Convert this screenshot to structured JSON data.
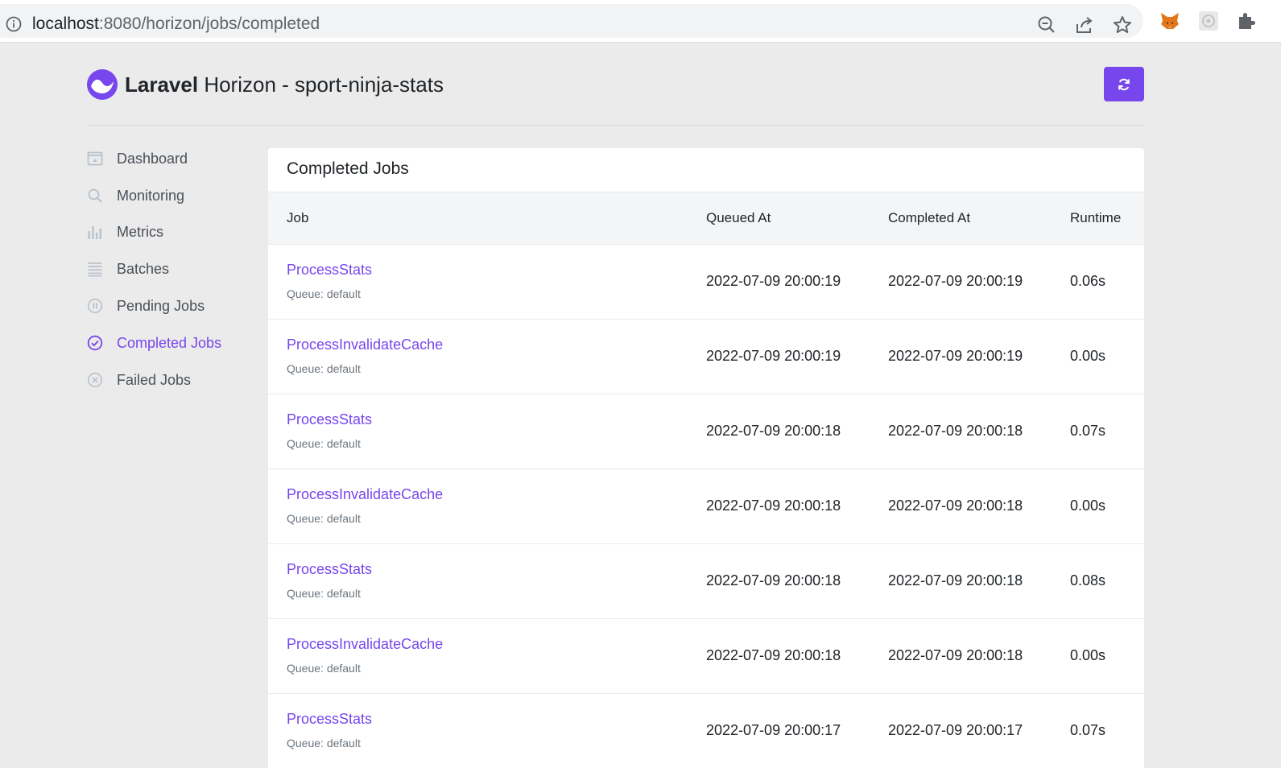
{
  "browser": {
    "url_host": "localhost",
    "url_rest": ":8080/horizon/jobs/completed"
  },
  "header": {
    "brand_bold": "Laravel",
    "brand_rest": "Horizon - sport-ninja-stats"
  },
  "sidebar": {
    "items": [
      {
        "label": "Dashboard",
        "icon": "dashboard-icon",
        "active": false
      },
      {
        "label": "Monitoring",
        "icon": "search-icon",
        "active": false
      },
      {
        "label": "Metrics",
        "icon": "bar-chart-icon",
        "active": false
      },
      {
        "label": "Batches",
        "icon": "list-icon",
        "active": false
      },
      {
        "label": "Pending Jobs",
        "icon": "pause-icon",
        "active": false
      },
      {
        "label": "Completed Jobs",
        "icon": "check-circle-icon",
        "active": true
      },
      {
        "label": "Failed Jobs",
        "icon": "x-circle-icon",
        "active": false
      }
    ]
  },
  "card": {
    "title": "Completed Jobs",
    "columns": {
      "job": "Job",
      "queued_at": "Queued At",
      "completed_at": "Completed At",
      "runtime": "Runtime"
    },
    "rows": [
      {
        "job": "ProcessStats",
        "queue": "Queue: default",
        "queued_at": "2022-07-09 20:00:19",
        "completed_at": "2022-07-09 20:00:19",
        "runtime": "0.06s"
      },
      {
        "job": "ProcessInvalidateCache",
        "queue": "Queue: default",
        "queued_at": "2022-07-09 20:00:19",
        "completed_at": "2022-07-09 20:00:19",
        "runtime": "0.00s"
      },
      {
        "job": "ProcessStats",
        "queue": "Queue: default",
        "queued_at": "2022-07-09 20:00:18",
        "completed_at": "2022-07-09 20:00:18",
        "runtime": "0.07s"
      },
      {
        "job": "ProcessInvalidateCache",
        "queue": "Queue: default",
        "queued_at": "2022-07-09 20:00:18",
        "completed_at": "2022-07-09 20:00:18",
        "runtime": "0.00s"
      },
      {
        "job": "ProcessStats",
        "queue": "Queue: default",
        "queued_at": "2022-07-09 20:00:18",
        "completed_at": "2022-07-09 20:00:18",
        "runtime": "0.08s"
      },
      {
        "job": "ProcessInvalidateCache",
        "queue": "Queue: default",
        "queued_at": "2022-07-09 20:00:18",
        "completed_at": "2022-07-09 20:00:18",
        "runtime": "0.00s"
      },
      {
        "job": "ProcessStats",
        "queue": "Queue: default",
        "queued_at": "2022-07-09 20:00:17",
        "completed_at": "2022-07-09 20:00:17",
        "runtime": "0.07s"
      }
    ]
  },
  "colors": {
    "accent": "#7746ec",
    "background": "#ebebeb",
    "muted_icon": "#b8c2cc"
  }
}
